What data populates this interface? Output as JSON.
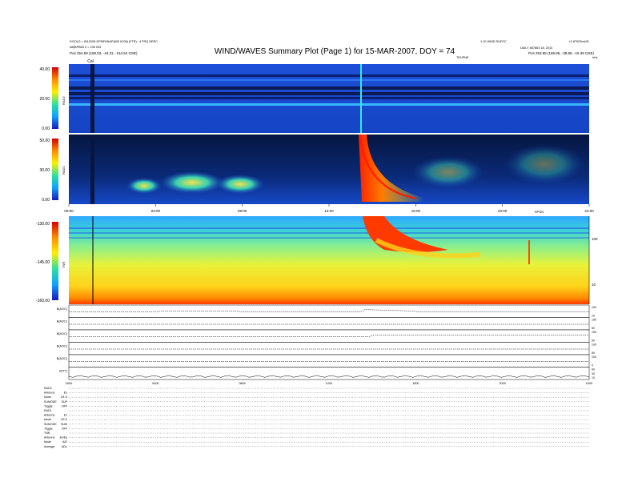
{
  "header": {
    "title": "WIND/WAVES Summary Plot (Page 1) for 15-MAR-2007, DOY = 74",
    "left_line1": "DOOLD = 8112008 GPMFANAP(600 6108) (FTR) : 4 FRQ NERC",
    "left_line2": "AB|BPB63 2 = 135 003",
    "left_line3": "Pos    254.59 (189.53, -43.31, -164.64 GSE)",
    "right_line1": "1.10 WIND SUFOC",
    "right_line2": "DAILY 857863 18, 2010",
    "right_line3": "Pos    253.85 (189.86, -38.89, -16.39 GSE)",
    "right_top_corner": "L2 87003mb31",
    "right_sub": "TEUPNE",
    "right_unit": "kHz",
    "cal_label": "Cal"
  },
  "chart_data": [
    {
      "type": "heatmap",
      "panel": "RAD2",
      "ylabel": "RAD2",
      "ylim": [
        0,
        40
      ],
      "yticks": [
        "40.00",
        "20.00",
        "0.00"
      ]
    },
    {
      "type": "heatmap",
      "panel": "RAD1",
      "ylabel": "RAD1",
      "ylim": [
        0,
        50
      ],
      "yticks": [
        "50.00",
        "30.00",
        "0.00"
      ],
      "xticks": [
        "00:00",
        "04:00",
        "08:00",
        "12:00",
        "16:00",
        "20:00",
        "24:00"
      ],
      "x_annotation": "RPSN"
    },
    {
      "type": "heatmap",
      "panel": "TNR",
      "ylabel": "TNR",
      "ylim": [
        -160,
        -130
      ],
      "yticks": [
        "-130.00",
        "-145.00",
        "-160.00"
      ],
      "right_ticks": [
        "100",
        "10"
      ]
    },
    {
      "type": "line",
      "panel": "magnetometer",
      "rows": [
        {
          "label": "B(AOC)",
          "right_ticks": [
            "100",
            "10"
          ]
        },
        {
          "label": "B(AOC)",
          "right_ticks": [
            "150",
            "50"
          ]
        },
        {
          "label": "B(AOC)",
          "right_ticks": [
            "150",
            "50"
          ]
        },
        {
          "label": "B(AOC)",
          "right_ticks": [
            "100",
            "50"
          ]
        },
        {
          "label": "B(AOC)",
          "right_ticks": [
            "100",
            "0"
          ]
        },
        {
          "label": "B(TT)",
          "right_ticks": [
            "60",
            "30",
            "10"
          ]
        }
      ],
      "xticks": [
        "0000",
        "0400",
        "0800",
        "1200",
        "1600",
        "2000",
        "2400"
      ]
    }
  ],
  "status": [
    {
      "k": "RAD2",
      "v": ""
    },
    {
      "k": "Antenna",
      "v": "Ex"
    },
    {
      "k": "Mode",
      "v": "LR-S"
    },
    {
      "k": "SUMODE",
      "v": "SUP"
    },
    {
      "k": "Toggle",
      "v": "OFF"
    },
    {
      "k": "RAD1",
      "v": ""
    },
    {
      "k": "Antenna",
      "v": "Ex"
    },
    {
      "k": "Mode",
      "v": "LR-Z"
    },
    {
      "k": "SUMODE",
      "v": "SUM"
    },
    {
      "k": "Toggle",
      "v": "OFF"
    },
    {
      "k": "TNR",
      "v": ""
    },
    {
      "k": "Antenna",
      "v": "Ex/Ey"
    },
    {
      "k": "Mode",
      "v": "A/D"
    },
    {
      "k": "Average",
      "v": "ADL"
    }
  ],
  "colors": {
    "panel_bg": "#0a1f4a",
    "burst": "#ff2a00",
    "tnr_top": "#39c6e6",
    "tnr_bottom": "#ff6a00"
  }
}
